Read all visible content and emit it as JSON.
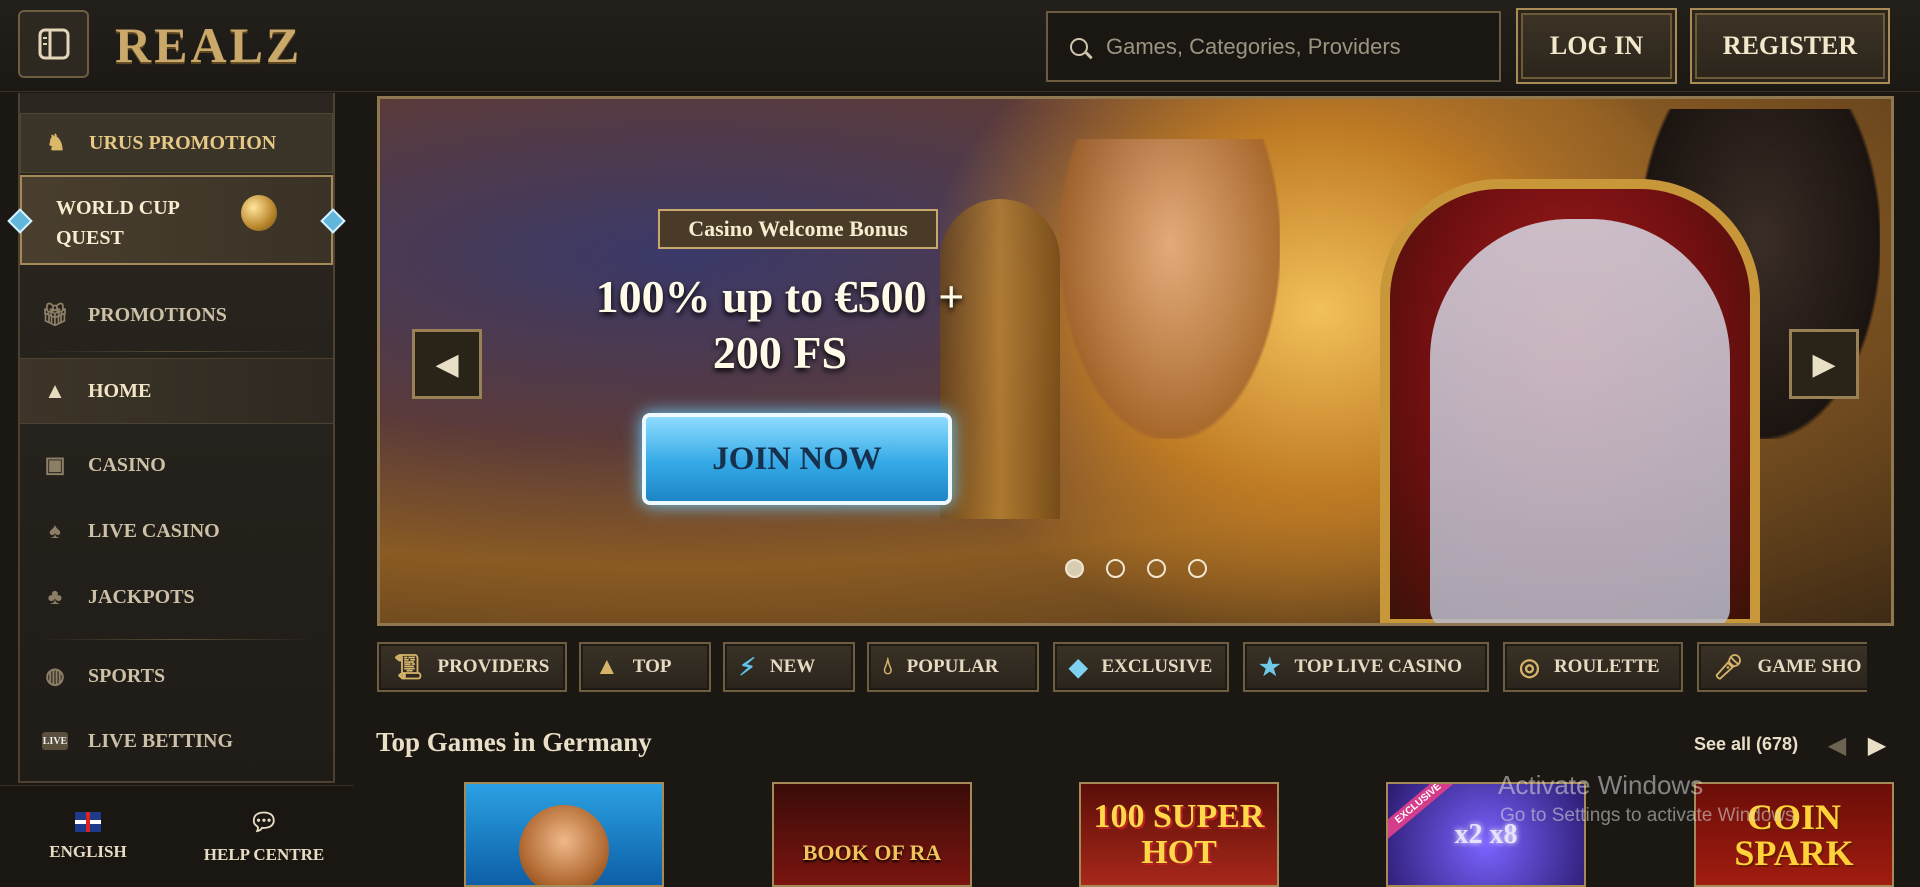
{
  "header": {
    "logo": "REALZ",
    "search_placeholder": "Games, Categories, Providers",
    "login_label": "LOG IN",
    "register_label": "REGISTER"
  },
  "sidebar": {
    "urus": "URUS PROMOTION",
    "worldcup_line1": "WORLD CUP",
    "worldcup_line2": "QUEST",
    "items": [
      {
        "label": "PROMOTIONS",
        "icon": "gift-icon"
      },
      {
        "label": "HOME",
        "icon": "pyramid-icon"
      },
      {
        "label": "CASINO",
        "icon": "slot-machine-icon"
      },
      {
        "label": "LIVE CASINO",
        "icon": "card-icon"
      },
      {
        "label": "JACKPOTS",
        "icon": "clover-icon"
      },
      {
        "label": "SPORTS",
        "icon": "ball-icon"
      },
      {
        "label": "LIVE BETTING",
        "icon": "live-icon"
      }
    ],
    "live_badge": "LIVE"
  },
  "footer_nav": {
    "language": "ENGLISH",
    "help": "HELP CENTRE"
  },
  "banner": {
    "tag": "Casino Welcome Bonus",
    "line1": "100% up to €500 +",
    "line2": "200 FS",
    "cta": "JOIN NOW",
    "slides": 4,
    "active_slide": 1
  },
  "categories": [
    {
      "label": "PROVIDERS",
      "icon": "scroll-icon"
    },
    {
      "label": "TOP",
      "icon": "pyramid-icon"
    },
    {
      "label": "NEW",
      "icon": "lightning-icon"
    },
    {
      "label": "POPULAR",
      "icon": "drop-icon"
    },
    {
      "label": "EXCLUSIVE",
      "icon": "diamond-icon"
    },
    {
      "label": "TOP LIVE CASINO",
      "icon": "star-icon"
    },
    {
      "label": "ROULETTE",
      "icon": "roulette-icon"
    },
    {
      "label": "GAME SHO",
      "icon": "microphone-icon"
    }
  ],
  "top_games": {
    "title": "Top Games in Germany",
    "see_all": "See all (678)",
    "games": [
      {
        "title": "",
        "accent": "#2f8fd1"
      },
      {
        "title": "BOOK OF RA",
        "accent": "#7a1410"
      },
      {
        "title": "100 SUPER HOT",
        "accent": "#8a1f12"
      },
      {
        "title": "x2 x8",
        "accent": "#3a2a8a"
      },
      {
        "title": "COIN SPARK",
        "accent": "#9b1a10"
      }
    ],
    "exclusive_badge": "EXCLUSIVE"
  },
  "overlay": {
    "title": "Activate Windows",
    "subtitle": "Go to Settings to activate Windows."
  },
  "colors": {
    "gold": "#c9a86a",
    "bg": "#1b1814",
    "cta_blue": "#34a9e6"
  }
}
